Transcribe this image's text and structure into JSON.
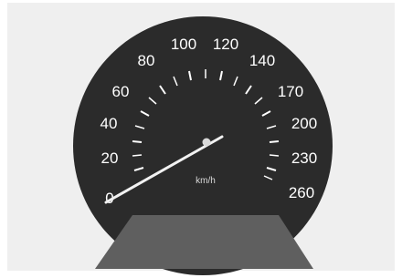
{
  "gauge": {
    "unit": "km/h",
    "scale_labels": [
      "0",
      "20",
      "40",
      "60",
      "80",
      "100",
      "120",
      "140",
      "170",
      "200",
      "230",
      "260"
    ],
    "needle_value": 0,
    "colors": {
      "dial": "#2b2b2b",
      "base": "#5f5f5f",
      "background": "#efefef",
      "markings": "#ffffff"
    }
  }
}
